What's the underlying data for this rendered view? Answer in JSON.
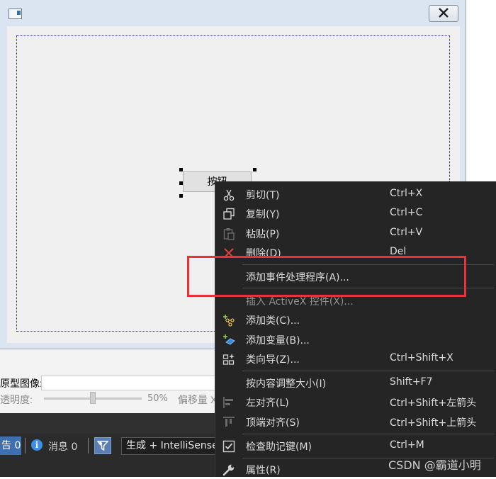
{
  "dialog": {
    "button_label": "按钮"
  },
  "properties": {
    "proto_image_label": "原型图像:",
    "transparency_label": "透明度:",
    "transparency_value": "50%",
    "offset_label": "偏移量 X"
  },
  "status_bar": {
    "warnings_label": "告 0",
    "messages_label": "消息 0",
    "build_filter_value": "生成 + IntelliSense"
  },
  "context_menu": {
    "items": [
      {
        "label": "剪切(T)",
        "shortcut": "Ctrl+X",
        "icon": "scissors-icon"
      },
      {
        "label": "复制(Y)",
        "shortcut": "Ctrl+C",
        "icon": "copy-icon"
      },
      {
        "label": "粘贴(P)",
        "shortcut": "Ctrl+V",
        "icon": "paste-icon"
      },
      {
        "label": "删除(D)",
        "shortcut": "Del",
        "icon": "delete-icon"
      },
      {
        "label": "添加事件处理程序(A)...",
        "shortcut": "",
        "icon": ""
      },
      {
        "label": "插入 ActiveX 控件(X)...",
        "shortcut": "",
        "icon": ""
      },
      {
        "label": "添加类(C)...",
        "shortcut": "",
        "icon": "add-class-icon"
      },
      {
        "label": "添加变量(B)...",
        "shortcut": "",
        "icon": "add-variable-icon"
      },
      {
        "label": "类向导(Z)...",
        "shortcut": "Ctrl+Shift+X",
        "icon": "class-wizard-icon"
      },
      {
        "label": "按内容调整大小(I)",
        "shortcut": "Shift+F7",
        "icon": ""
      },
      {
        "label": "左对齐(L)",
        "shortcut": "Ctrl+Shift+左箭头",
        "icon": "align-left-icon"
      },
      {
        "label": "顶端对齐(S)",
        "shortcut": "Ctrl+Shift+上箭头",
        "icon": "align-top-icon"
      },
      {
        "label": "检查助记键(M)",
        "shortcut": "Ctrl+M",
        "icon": "check-mnemonic-icon"
      },
      {
        "label": "属性(R)",
        "shortcut": "",
        "icon": "wrench-icon"
      }
    ]
  },
  "watermark": "CSDN @霸道小明",
  "colors": {
    "highlight_box": "#e8323a",
    "menu_bg": "#252526",
    "accent": "#3e6fb0"
  }
}
